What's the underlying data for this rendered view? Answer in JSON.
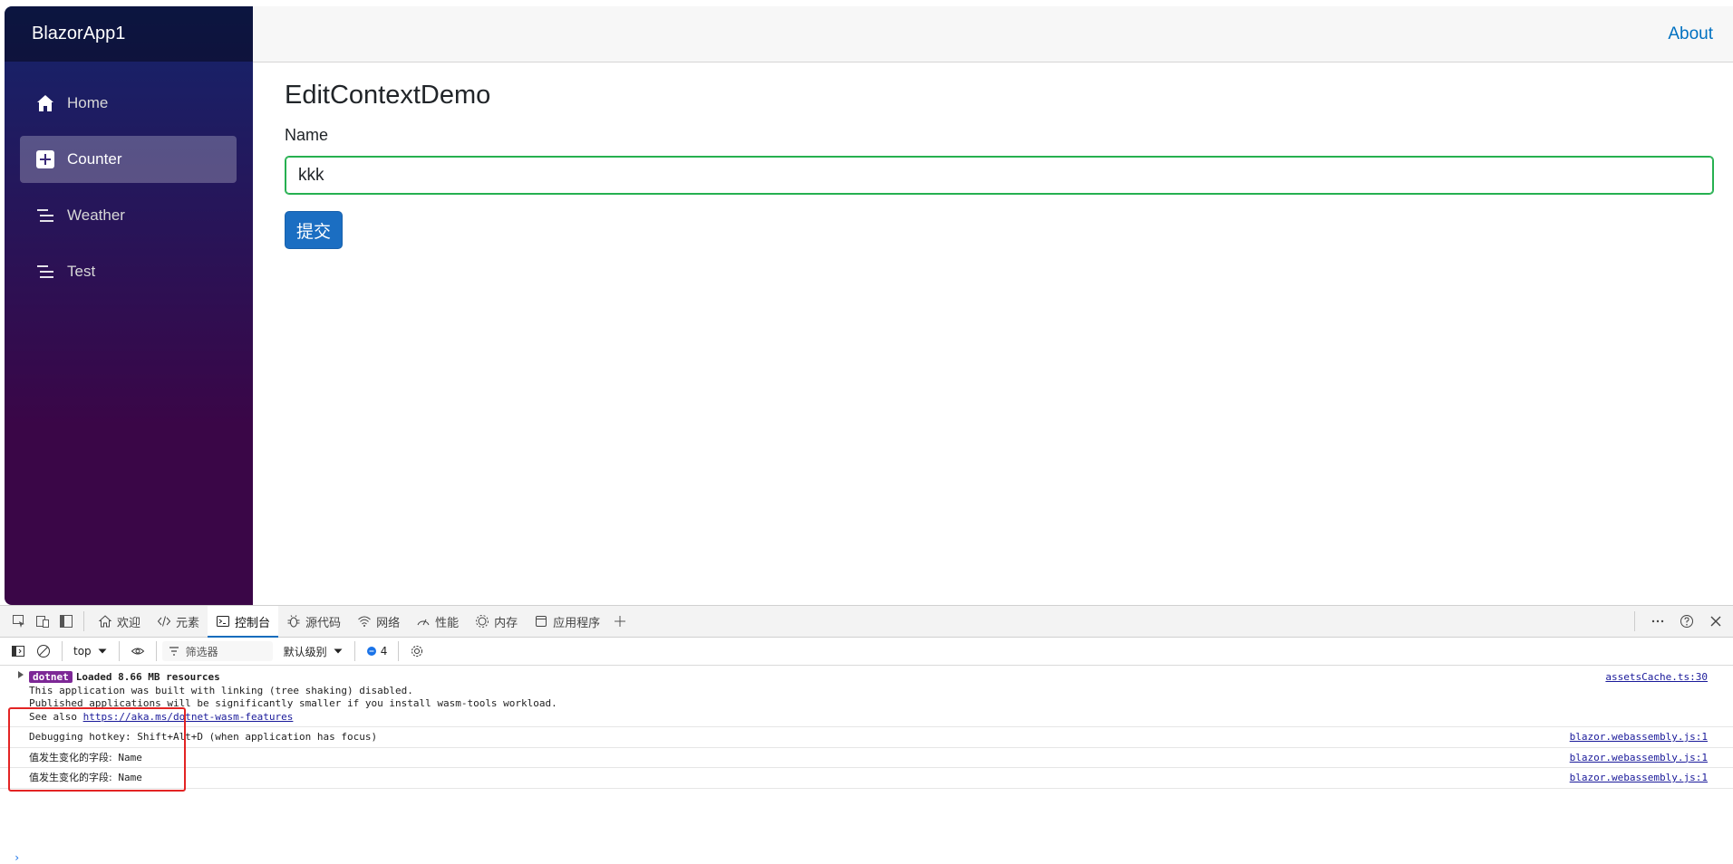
{
  "app": {
    "brand": "BlazorApp1",
    "nav": [
      {
        "label": "Home",
        "icon": "home-icon",
        "active": false
      },
      {
        "label": "Counter",
        "icon": "plus-square-icon",
        "active": true
      },
      {
        "label": "Weather",
        "icon": "list-icon",
        "active": false
      },
      {
        "label": "Test",
        "icon": "list-icon",
        "active": false
      }
    ],
    "top_link": "About",
    "page_title": "EditContextDemo",
    "name_label": "Name",
    "name_value": "kkk",
    "submit_label": "提交"
  },
  "devtools": {
    "tabs": [
      {
        "label": "欢迎",
        "icon": "home-icon"
      },
      {
        "label": "元素",
        "icon": "code-icon"
      },
      {
        "label": "控制台",
        "icon": "console-icon",
        "active": true
      },
      {
        "label": "源代码",
        "icon": "bug-icon"
      },
      {
        "label": "网络",
        "icon": "wifi-icon"
      },
      {
        "label": "性能",
        "icon": "gauge-icon"
      },
      {
        "label": "内存",
        "icon": "memory-icon"
      },
      {
        "label": "应用程序",
        "icon": "app-icon"
      }
    ],
    "toolbar": {
      "context": "top",
      "filter_placeholder": "筛选器",
      "level": "默认级别",
      "message_count": "4"
    },
    "console": {
      "group": {
        "badge": "dotnet",
        "title": "Loaded 8.66 MB resources",
        "lines": [
          "This application was built with linking (tree shaking) disabled.",
          "Published applications will be significantly smaller if you install wasm-tools workload."
        ],
        "see_also_prefix": "See also ",
        "see_also_link": "https://aka.ms/dotnet-wasm-features",
        "source": "assetsCache.ts:30"
      },
      "messages": [
        {
          "text": "Debugging hotkey: Shift+Alt+D (when application has focus)",
          "source": "blazor.webassembly.js:1"
        },
        {
          "prefix": "值发生变化的字段:",
          "field": " Name",
          "source": "blazor.webassembly.js:1"
        },
        {
          "prefix": "值发生变化的字段:",
          "field": " Name",
          "source": "blazor.webassembly.js:1"
        }
      ]
    }
  },
  "colors": {
    "sidebar_top": "#14246b",
    "sidebar_bottom": "#3a0647",
    "button_primary": "#1b6ec2",
    "link": "#0071c1",
    "highlight_box": "#e32424"
  }
}
